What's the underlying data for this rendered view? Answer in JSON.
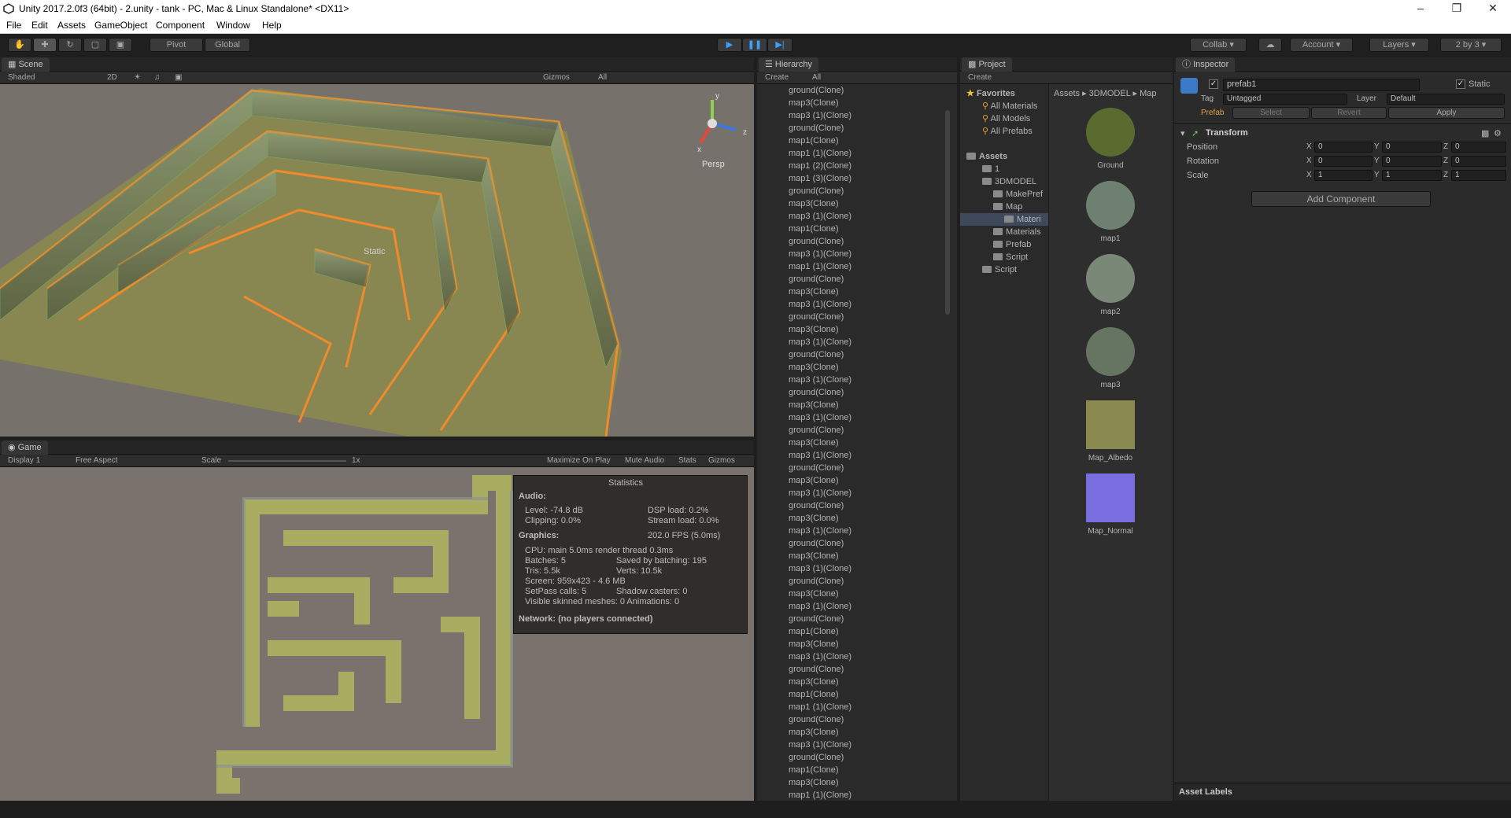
{
  "window": {
    "title": "Unity 2017.2.0f3 (64bit) - 2.unity - tank - PC, Mac & Linux Standalone* <DX11>"
  },
  "menu": [
    "File",
    "Edit",
    "Assets",
    "GameObject",
    "Component",
    "Window",
    "Help"
  ],
  "toolbar": {
    "pivot": "Pivot",
    "global": "Global",
    "collab": "Collab",
    "account": "Account",
    "layers": "Layers",
    "layout": "2 by 3"
  },
  "scene": {
    "tab": "Scene",
    "shading": "Shaded",
    "mode2d": "2D",
    "gizmos": "Gizmos",
    "search": "All",
    "persp": "Persp",
    "static_label": "Static",
    "axis_y": "y",
    "axis_z": "z",
    "axis_x": "x"
  },
  "game": {
    "tab": "Game",
    "display": "Display 1",
    "aspect": "Free Aspect",
    "scale_label": "Scale",
    "scale_value": "1x",
    "maximize": "Maximize On Play",
    "mute": "Mute Audio",
    "stats": "Stats",
    "gizmos": "Gizmos"
  },
  "statistics": {
    "title": "Statistics",
    "audio_header": "Audio:",
    "level": "Level: -74.8 dB",
    "clipping": "Clipping: 0.0%",
    "dsp": "DSP load: 0.2%",
    "stream": "Stream load: 0.0%",
    "graphics_header": "Graphics:",
    "fps": "202.0 FPS (5.0ms)",
    "cpu": "CPU: main 5.0ms  render thread 0.3ms",
    "batches": "Batches: 5",
    "saved": "Saved by batching: 195",
    "tris": "Tris: 5.5k",
    "verts": "Verts: 10.5k",
    "screen": "Screen: 959x423 - 4.6 MB",
    "setpass": "SetPass calls: 5",
    "shadow": "Shadow casters: 0",
    "skinned": "Visible skinned meshes: 0  Animations: 0",
    "network": "Network: (no players connected)"
  },
  "hierarchy": {
    "tab": "Hierarchy",
    "create": "Create",
    "search": "All",
    "items": [
      "ground(Clone)",
      "map3(Clone)",
      "map3 (1)(Clone)",
      "ground(Clone)",
      "map1(Clone)",
      "map1 (1)(Clone)",
      "map1 (2)(Clone)",
      "map1 (3)(Clone)",
      "ground(Clone)",
      "map3(Clone)",
      "map3 (1)(Clone)",
      "map1(Clone)",
      "ground(Clone)",
      "map3 (1)(Clone)",
      "map1 (1)(Clone)",
      "ground(Clone)",
      "map3(Clone)",
      "map3 (1)(Clone)",
      "ground(Clone)",
      "map3(Clone)",
      "map3 (1)(Clone)",
      "ground(Clone)",
      "map3(Clone)",
      "map3 (1)(Clone)",
      "ground(Clone)",
      "map3(Clone)",
      "map3 (1)(Clone)",
      "ground(Clone)",
      "map3(Clone)",
      "map3 (1)(Clone)",
      "ground(Clone)",
      "map3(Clone)",
      "map3 (1)(Clone)",
      "ground(Clone)",
      "map3(Clone)",
      "map3 (1)(Clone)",
      "ground(Clone)",
      "map3(Clone)",
      "map3 (1)(Clone)",
      "ground(Clone)",
      "map3(Clone)",
      "map3 (1)(Clone)",
      "ground(Clone)",
      "map1(Clone)",
      "map3(Clone)",
      "map3 (1)(Clone)",
      "ground(Clone)",
      "map3(Clone)",
      "map1(Clone)",
      "map1 (1)(Clone)",
      "ground(Clone)",
      "map3(Clone)",
      "map3 (1)(Clone)",
      "ground(Clone)",
      "map1(Clone)",
      "map3(Clone)",
      "map1 (1)(Clone)"
    ]
  },
  "project": {
    "tab": "Project",
    "create": "Create",
    "favorites": "Favorites",
    "fav_items": [
      "All Materials",
      "All Models",
      "All Prefabs"
    ],
    "assets": "Assets",
    "tree": [
      "1",
      "3DMODEL",
      "MakePref",
      "Map",
      "Materi",
      "Materials",
      "Prefab",
      "Script",
      "Script"
    ],
    "breadcrumb": [
      "Assets",
      "3DMODEL",
      "Map"
    ],
    "grid": [
      {
        "name": "Ground",
        "color": "#5b6a2e"
      },
      {
        "name": "map1",
        "color": "#6e8070"
      },
      {
        "name": "map2",
        "color": "#7a8878"
      },
      {
        "name": "map3",
        "color": "#667462"
      },
      {
        "name": "Map_Albedo",
        "color": "#8a8a50"
      },
      {
        "name": "Map_Normal",
        "color": "#7a6de0"
      }
    ]
  },
  "inspector": {
    "tab": "Inspector",
    "object_name": "prefab1",
    "static": "Static",
    "tag_label": "Tag",
    "tag_value": "Untagged",
    "layer_label": "Layer",
    "layer_value": "Default",
    "prefab": "Prefab",
    "select": "Select",
    "revert": "Revert",
    "apply": "Apply",
    "transform": "Transform",
    "position": "Position",
    "rotation": "Rotation",
    "scale": "Scale",
    "pos": {
      "x": "0",
      "y": "0",
      "z": "0"
    },
    "rot": {
      "x": "0",
      "y": "0",
      "z": "0"
    },
    "scl": {
      "x": "1",
      "y": "1",
      "z": "1"
    },
    "x": "X",
    "y": "Y",
    "z": "Z",
    "add_component": "Add Component",
    "asset_labels": "Asset Labels"
  }
}
